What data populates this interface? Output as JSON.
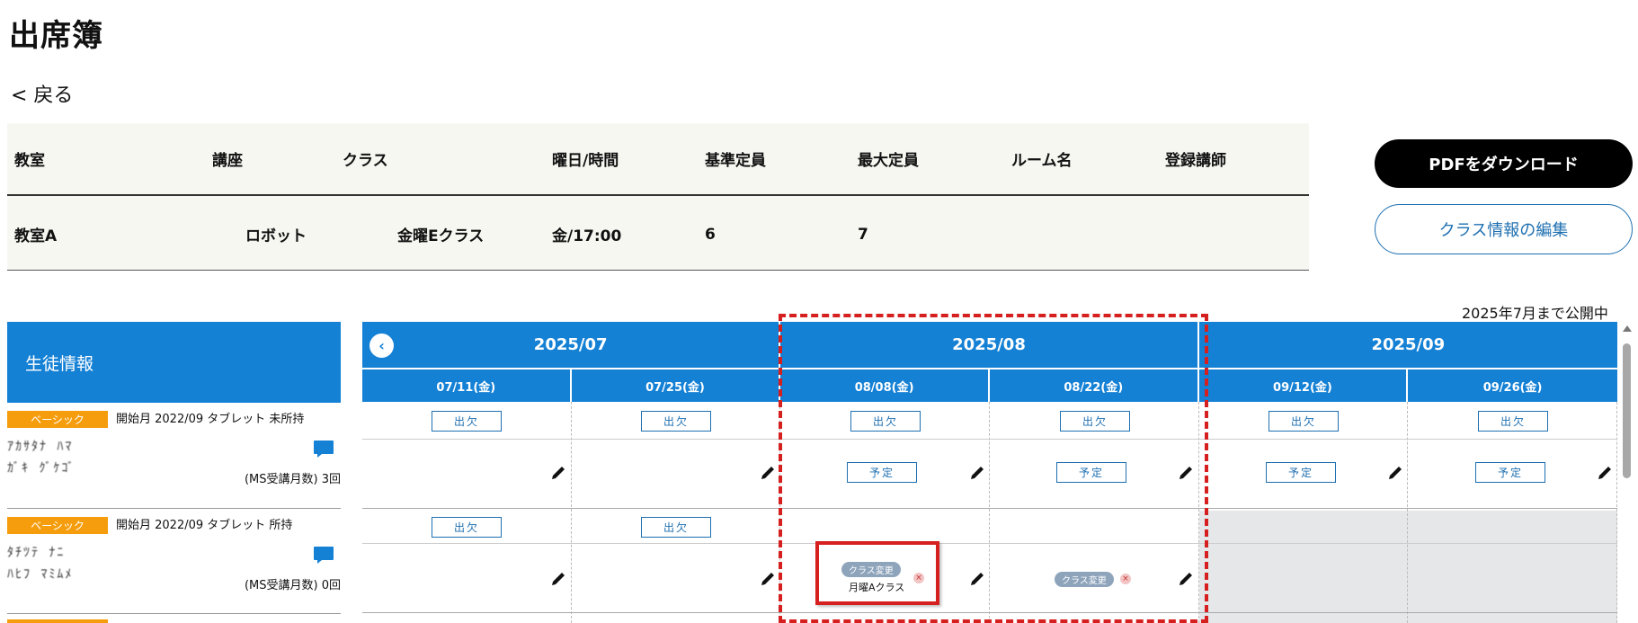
{
  "page": {
    "title": "出席簿",
    "back_label": "< 戻る"
  },
  "class_info": {
    "headers": [
      "教室",
      "講座",
      "クラス",
      "曜日/時間",
      "基準定員",
      "最大定員",
      "ルーム名",
      "登録講師"
    ],
    "values": [
      "教室A",
      "ロボット",
      "金曜Eクラス",
      "金/17:00",
      "6",
      "7",
      "",
      ""
    ]
  },
  "actions": {
    "pdf_label": "PDFをダウンロード",
    "edit_label": "クラス情報の編集"
  },
  "publish_note": "2025年7月まで公開中",
  "student_panel": {
    "title": "生徒情報",
    "students": [
      {
        "badge": "ベーシック",
        "meta": "開始月 2022/09  タブレット 未所持",
        "name_line1": "ｱｶｻﾀﾅ ﾊﾏ",
        "name_line2": "ｶﾞｷ  ｸﾞｹｺﾞ",
        "count": "(MS受講月数) 3回"
      },
      {
        "badge": "ベーシック",
        "meta": "開始月 2022/09  タブレット 所持",
        "name_line1": "ﾀﾁﾂﾃ ﾅﾆ",
        "name_line2": "ﾊﾋﾌ  ﾏﾐﾑﾒ",
        "count": "(MS受講月数) 0回"
      }
    ]
  },
  "schedule": {
    "months": [
      "2025/07",
      "2025/08",
      "2025/09"
    ],
    "dates": [
      "07/11(金)",
      "07/25(金)",
      "08/08(金)",
      "08/22(金)",
      "09/12(金)",
      "09/26(金)"
    ],
    "attendance_label": "出欠",
    "planned_label": "予定",
    "class_change_label": "クラス変更",
    "class_change_target": "月曜Aクラス",
    "remove_symbol": "×"
  },
  "colors": {
    "primary": "#1581d5",
    "badge": "#f59d0c",
    "highlight": "#d61f1f",
    "chip": "#8ea4bb",
    "disabled": "#e6e7e9"
  }
}
